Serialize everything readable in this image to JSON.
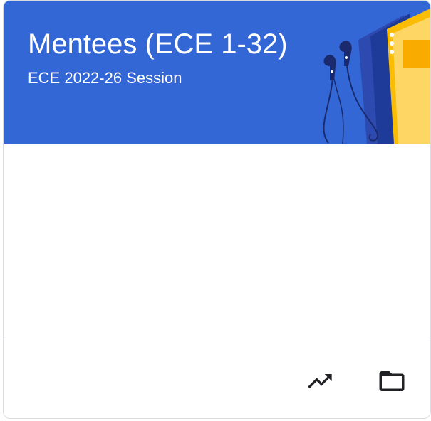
{
  "card": {
    "title": "Mentees (ECE 1-32)",
    "section": "ECE 2022-26 Session",
    "banner_color": "#3367d6",
    "theme_illustration": "headphones-and-notebook"
  },
  "menu": {
    "icon": "more-vert-icon"
  },
  "footer": {
    "actions": [
      {
        "icon": "trending-up-icon",
        "name": "open-gradebook"
      },
      {
        "icon": "folder-icon",
        "name": "open-class-folder"
      }
    ],
    "icon_color": "#202124"
  }
}
